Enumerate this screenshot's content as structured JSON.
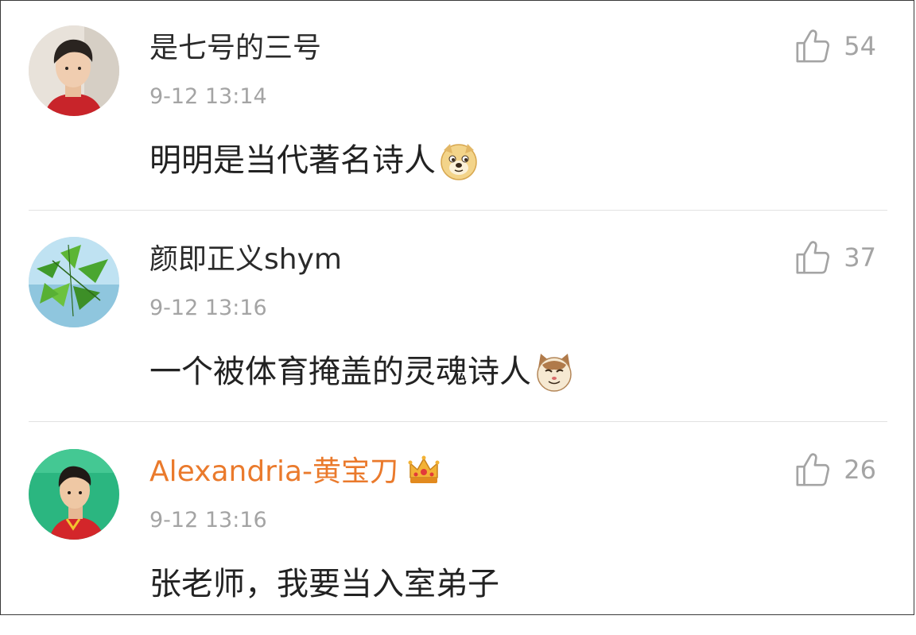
{
  "comments": [
    {
      "username": "是七号的三号",
      "timestamp": "9-12 13:14",
      "likes": "54",
      "text": "明明是当代著名诗人",
      "emoji": "doge-emoji",
      "avatar": "avatar-young-man-red-jacket",
      "username_color": "#2a2a2a"
    },
    {
      "username": "颜即正义shym",
      "timestamp": "9-12 13:16",
      "likes": "37",
      "text": "一个被体育掩盖的灵魂诗人",
      "emoji": "cat-face-emoji",
      "avatar": "avatar-green-leaves",
      "username_color": "#2a2a2a"
    },
    {
      "username": "Alexandria-黄宝刀",
      "timestamp": "9-12 13:16",
      "likes": "26",
      "text": "张老师，我要当入室弟子",
      "emoji": "",
      "avatar": "avatar-athlete-green-background",
      "username_color": "#ea7a2c",
      "badge": "crown-badge-icon"
    }
  ],
  "colors": {
    "meta_gray": "#a4a4a4",
    "vip_orange": "#ea7a2c",
    "text": "#222222",
    "divider": "#e2e2e2"
  }
}
